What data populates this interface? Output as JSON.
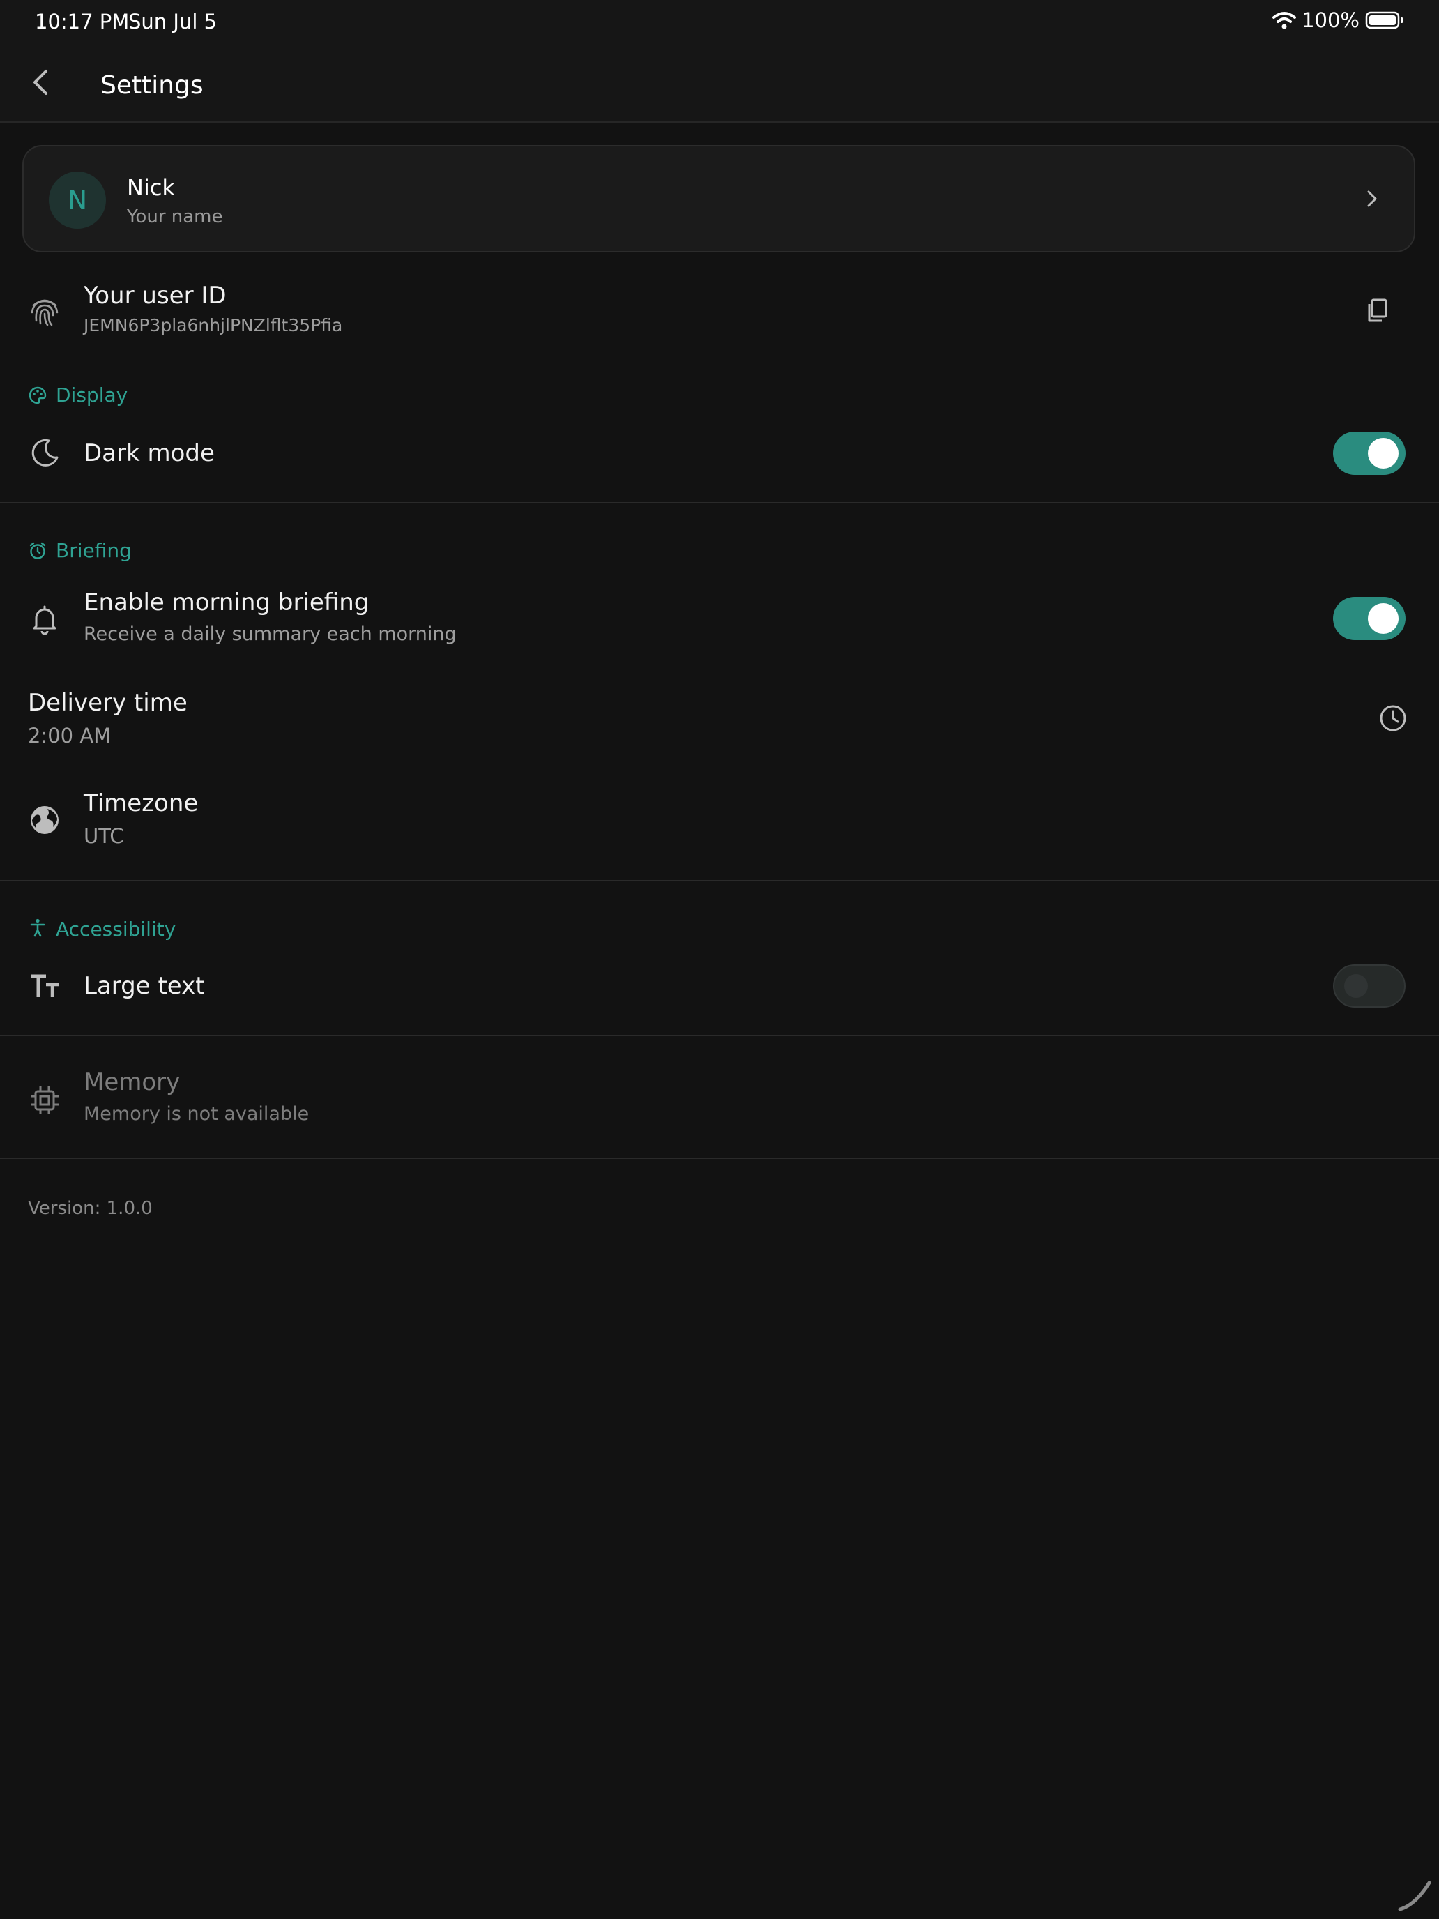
{
  "status_bar": {
    "time": "10:17 PM",
    "date": "Sun Jul 5",
    "battery": "100%"
  },
  "app_bar": {
    "title": "Settings"
  },
  "profile": {
    "initial": "N",
    "name": "Nick",
    "subtitle": "Your name"
  },
  "user_id": {
    "title": "Your user ID",
    "value": "JEMN6P3pla6nhjlPNZlflt35Pfia"
  },
  "display": {
    "section_label": "Display",
    "dark_mode": {
      "label": "Dark mode",
      "enabled": true
    }
  },
  "briefing": {
    "section_label": "Briefing",
    "enable": {
      "label": "Enable morning briefing",
      "subtitle": "Receive a daily summary each morning",
      "enabled": true
    },
    "delivery": {
      "label": "Delivery time",
      "value": "2:00 AM"
    },
    "timezone": {
      "label": "Timezone",
      "value": "UTC"
    }
  },
  "accessibility": {
    "section_label": "Accessibility",
    "large_text": {
      "label": "Large text",
      "enabled": false
    }
  },
  "memory": {
    "label": "Memory",
    "subtitle": "Memory is not available"
  },
  "version": "Version: 1.0.0",
  "colors": {
    "accent": "#2a8c7f",
    "background": "#121212"
  }
}
